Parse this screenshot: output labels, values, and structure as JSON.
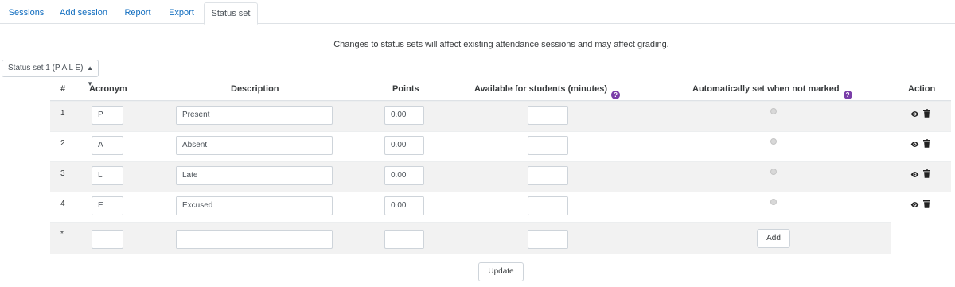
{
  "tabs": [
    {
      "label": "Sessions"
    },
    {
      "label": "Add session"
    },
    {
      "label": "Report"
    },
    {
      "label": "Export"
    },
    {
      "label": "Status set",
      "active": true
    }
  ],
  "notice": "Changes to status sets will affect existing attendance sessions and may affect grading.",
  "status_set_select": {
    "value": "Status set 1 (P A L E)"
  },
  "table": {
    "headers": {
      "number": "#",
      "acronym": "Acronym",
      "description": "Description",
      "points": "Points",
      "available": "Available for students (minutes)",
      "auto_set": "Automatically set when not marked",
      "action": "Action"
    },
    "rows": [
      {
        "number": "1",
        "acronym": "P",
        "description": "Present",
        "points": "0.00",
        "available": ""
      },
      {
        "number": "2",
        "acronym": "A",
        "description": "Absent",
        "points": "0.00",
        "available": ""
      },
      {
        "number": "3",
        "acronym": "L",
        "description": "Late",
        "points": "0.00",
        "available": ""
      },
      {
        "number": "4",
        "acronym": "E",
        "description": "Excused",
        "points": "0.00",
        "available": ""
      }
    ],
    "new_row": {
      "number": "*",
      "acronym": "",
      "description": "",
      "points": "",
      "available": "",
      "add_label": "Add"
    }
  },
  "update_label": "Update",
  "colors": {
    "link": "#0f6cbf",
    "help_icon": "#7a3ea8",
    "row_alt": "#f2f2f2"
  },
  "icons": {
    "help": "question-circle",
    "view": "eye",
    "delete": "trash"
  }
}
